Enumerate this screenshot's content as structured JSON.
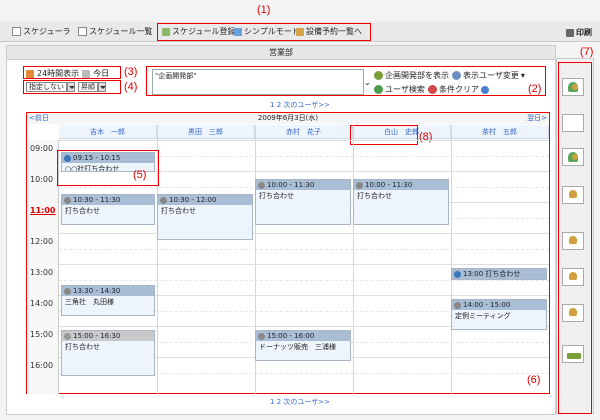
{
  "annotations": {
    "a1": "(1)",
    "a2": "(2)",
    "a3": "(3)",
    "a4": "(4)",
    "a5": "(5)",
    "a6": "(6)",
    "a7": "(7)",
    "a8": "(8)"
  },
  "topbar": {
    "tab1": "スケジューラ",
    "tab2": "スケジュール一覧",
    "print": "印刷"
  },
  "menu": {
    "register": "スケジュール登録",
    "simple": "シンプルモード",
    "equipment": "設備予約一覧へ"
  },
  "dept": "営業部",
  "options": {
    "h24": "24時間表示",
    "today": "今日",
    "filter": "指定しない",
    "order": "昇順"
  },
  "group": {
    "value": "\"企画開発部\""
  },
  "buttons": {
    "show_dept": "企画開発部を表示",
    "display_change": "表示ユーザ変更",
    "user_search": "ユーザ検索",
    "clear": "条件クリア"
  },
  "pager": {
    "pages": "1 2",
    "next": "次のユーザ>>"
  },
  "cal": {
    "prev": "<前日",
    "date": "2009年6月3日(水)",
    "next": "翌日>"
  },
  "users": [
    "吉木　一郎",
    "黒田　三郎",
    "赤村　花子",
    "白山　史郎",
    "茶村　五郎"
  ],
  "times": [
    "09:00",
    "10:00",
    "11:00",
    "12:00",
    "13:00",
    "14:00",
    "15:00",
    "16:00"
  ],
  "events": [
    {
      "time": "09:15 - 10:15",
      "title": "○○社打ち合わせ"
    },
    {
      "time": "10:00 - 11:30",
      "title": "打ち合わせ"
    },
    {
      "time": "10:30 - 11:30",
      "title": "打ち合わせ"
    },
    {
      "time": "10:30 - 12:00",
      "title": "打ち合わせ"
    },
    {
      "time": "10:00 - 11:30",
      "title": "打ち合わせ"
    },
    {
      "time": "13:00 打ち合わせ",
      "title": ""
    },
    {
      "time": "13:30 - 14:30",
      "title": "三角社　丸田様"
    },
    {
      "time": "14:00 - 15:00",
      "title": "定例ミーティング"
    },
    {
      "time": "15:00 - 16:30",
      "title": "打ち合わせ"
    },
    {
      "time": "15:00 - 16:00",
      "title": "ドーナッツ販売　三浦様"
    }
  ]
}
